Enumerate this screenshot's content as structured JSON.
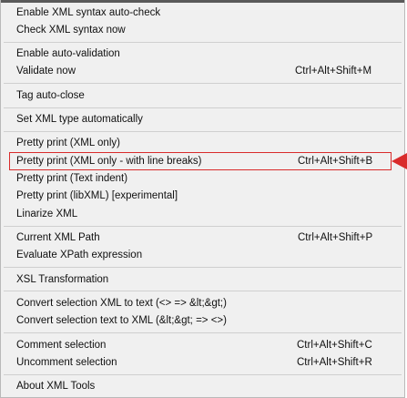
{
  "menu": {
    "items": [
      {
        "label": "Enable XML syntax auto-check",
        "shortcut": ""
      },
      {
        "label": "Check XML syntax now",
        "shortcut": ""
      },
      {
        "label": "Enable auto-validation",
        "shortcut": ""
      },
      {
        "label": "Validate now",
        "shortcut": "Ctrl+Alt+Shift+M"
      },
      {
        "label": "Tag auto-close",
        "shortcut": ""
      },
      {
        "label": "Set XML type automatically",
        "shortcut": ""
      },
      {
        "label": "Pretty print (XML only)",
        "shortcut": ""
      },
      {
        "label": "Pretty print (XML only - with line breaks)",
        "shortcut": "Ctrl+Alt+Shift+B"
      },
      {
        "label": "Pretty print (Text indent)",
        "shortcut": ""
      },
      {
        "label": "Pretty print (libXML) [experimental]",
        "shortcut": ""
      },
      {
        "label": "Linarize XML",
        "shortcut": ""
      },
      {
        "label": "Current XML Path",
        "shortcut": "Ctrl+Alt+Shift+P"
      },
      {
        "label": "Evaluate XPath expression",
        "shortcut": ""
      },
      {
        "label": "XSL Transformation",
        "shortcut": ""
      },
      {
        "label": "Convert selection XML to text (<> => &lt;&gt;)",
        "shortcut": ""
      },
      {
        "label": "Convert selection text to XML (&lt;&gt; => <>)",
        "shortcut": ""
      },
      {
        "label": "Comment selection",
        "shortcut": "Ctrl+Alt+Shift+C"
      },
      {
        "label": "Uncomment selection",
        "shortcut": "Ctrl+Alt+Shift+R"
      },
      {
        "label": "About XML Tools",
        "shortcut": ""
      }
    ]
  },
  "colors": {
    "menu_bg": "#f0f0f0",
    "highlight_border": "#d92b2b",
    "arrow": "#d92b2b",
    "separator": "#cfcfcf"
  },
  "icons": [
    "red-arrow-pointer-icon"
  ]
}
